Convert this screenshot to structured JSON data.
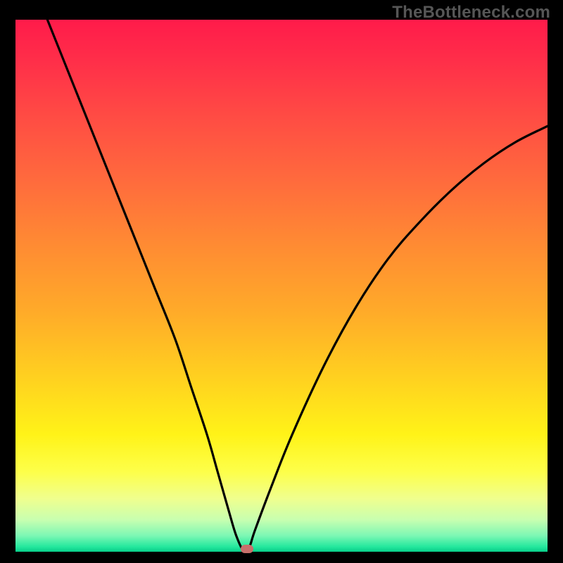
{
  "watermark": "TheBottleneck.com",
  "chart_data": {
    "type": "line",
    "title": "",
    "xlabel": "",
    "ylabel": "",
    "xlim": [
      0,
      100
    ],
    "ylim": [
      0,
      100
    ],
    "x": [
      6,
      10,
      14,
      18,
      22,
      26,
      30,
      33,
      36,
      38,
      40,
      41.5,
      43,
      44,
      45,
      48,
      52,
      58,
      64,
      70,
      76,
      82,
      88,
      94,
      100
    ],
    "values": [
      100,
      90,
      80,
      70,
      60,
      50,
      40,
      31,
      22,
      15,
      8,
      3,
      0,
      1,
      4,
      12,
      22,
      35,
      46,
      55,
      62,
      68,
      73,
      77,
      80
    ],
    "marker": {
      "x": 43.5,
      "y": 0.5
    },
    "background_gradient": {
      "direction": "vertical",
      "stops": [
        {
          "pos": 0.0,
          "color": "#ff1b4a"
        },
        {
          "pos": 0.3,
          "color": "#ff6a3d"
        },
        {
          "pos": 0.68,
          "color": "#ffd31f"
        },
        {
          "pos": 0.9,
          "color": "#f0ff8e"
        },
        {
          "pos": 1.0,
          "color": "#08cf8a"
        }
      ]
    }
  }
}
